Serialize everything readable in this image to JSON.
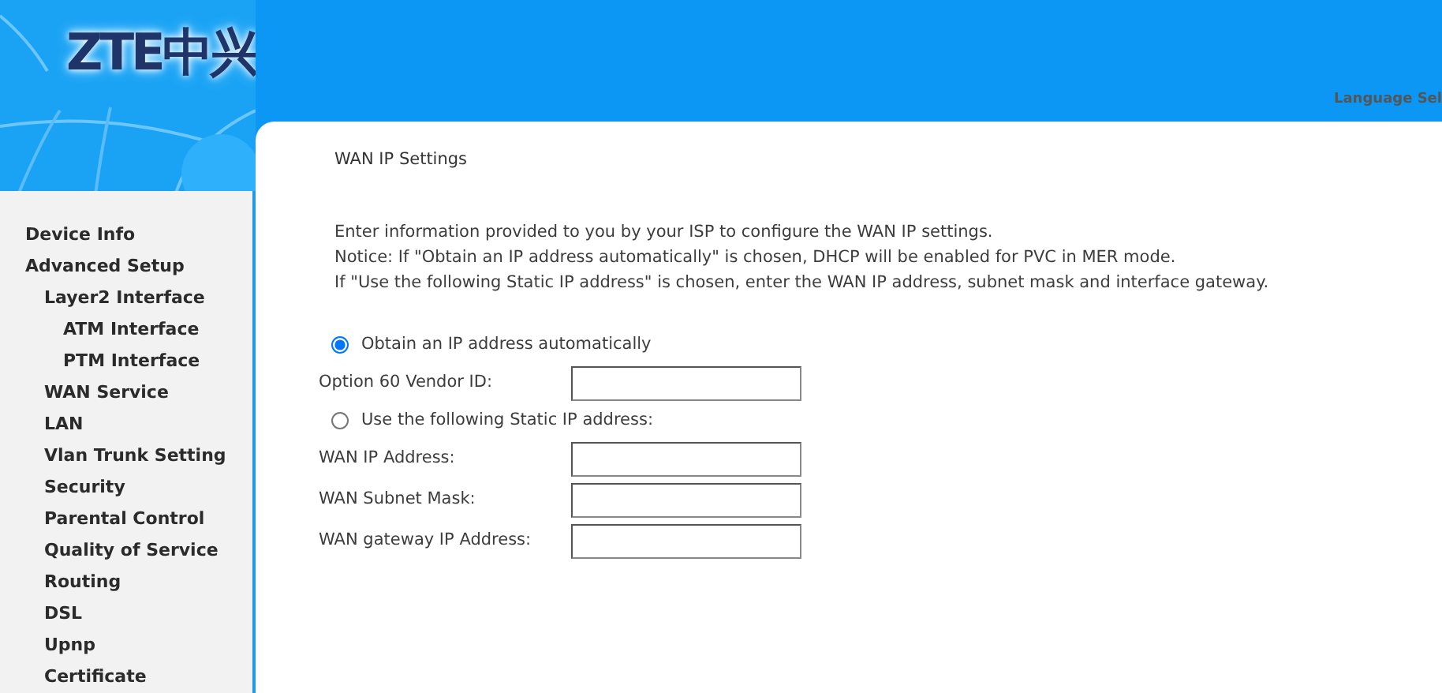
{
  "header": {
    "logo": "ZTE中兴",
    "language_label": "Language Sel"
  },
  "sidebar": {
    "items": [
      {
        "label": "Device Info"
      },
      {
        "label": "Advanced Setup",
        "children": [
          {
            "label": "Layer2 Interface",
            "children": [
              {
                "label": "ATM Interface"
              },
              {
                "label": "PTM Interface"
              }
            ]
          },
          {
            "label": "WAN Service"
          },
          {
            "label": "LAN"
          },
          {
            "label": "Vlan Trunk Setting"
          },
          {
            "label": "Security"
          },
          {
            "label": "Parental Control"
          },
          {
            "label": "Quality of Service"
          },
          {
            "label": "Routing"
          },
          {
            "label": "DSL"
          },
          {
            "label": "Upnp"
          },
          {
            "label": "Certificate"
          }
        ]
      }
    ]
  },
  "content": {
    "title": "WAN IP Settings",
    "paragraphs": [
      "Enter information provided to you by your ISP to configure the WAN IP settings.",
      "Notice: If \"Obtain an IP address automatically\" is chosen, DHCP will be enabled for PVC in MER mode.",
      "If \"Use the following Static IP address\" is chosen, enter the WAN IP address, subnet mask and interface gateway."
    ],
    "rows": [
      {
        "kind": "radio",
        "label": "Obtain an IP address automatically",
        "selected": true
      },
      {
        "kind": "field",
        "label": "Option 60 Vendor ID:"
      },
      {
        "kind": "radio",
        "label": "Use the following Static IP address:",
        "selected": false
      },
      {
        "kind": "field",
        "label": "WAN IP Address:"
      },
      {
        "kind": "field",
        "label": "WAN Subnet Mask:"
      },
      {
        "kind": "field",
        "label": "WAN gateway IP Address:"
      }
    ]
  }
}
